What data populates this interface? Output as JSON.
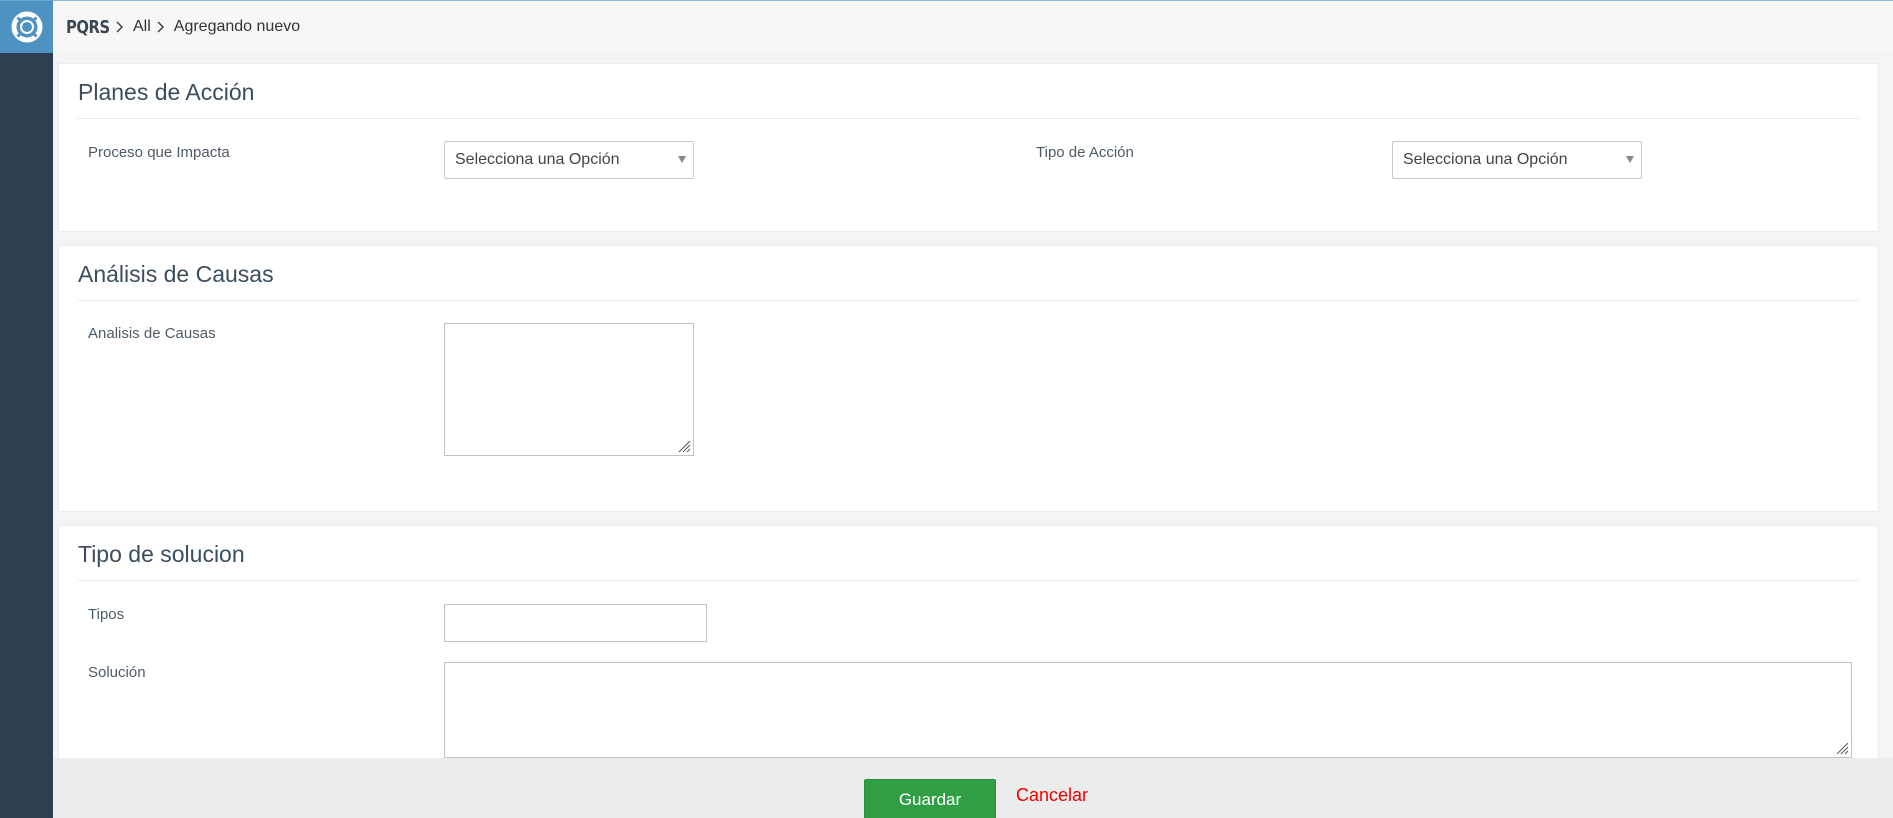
{
  "app": {
    "brand": "PQRS",
    "breadcrumb": [
      "All",
      "Agregando nuevo"
    ],
    "logo_icon": "lifebuoy-icon"
  },
  "sections": {
    "planes": {
      "title": "Planes de Acción",
      "proceso_label": "Proceso que Impacta",
      "proceso_value": "Selecciona una Opción",
      "tipo_label": "Tipo de Acción",
      "tipo_value": "Selecciona una Opción"
    },
    "analisis": {
      "title": "Análisis de Causas",
      "field_label": "Analisis de Causas",
      "field_value": ""
    },
    "solucion": {
      "title": "Tipo de solucion",
      "tipos_label": "Tipos",
      "tipos_value": "",
      "solucion_label": "Solución",
      "solucion_value": ""
    }
  },
  "footer": {
    "save_label": "Guardar",
    "cancel_label": "Cancelar"
  },
  "colors": {
    "sidebar": "#2c3e50",
    "logo_bg": "#4e92c2",
    "save_button": "#2f9e44",
    "cancel_link": "#ee0000"
  }
}
